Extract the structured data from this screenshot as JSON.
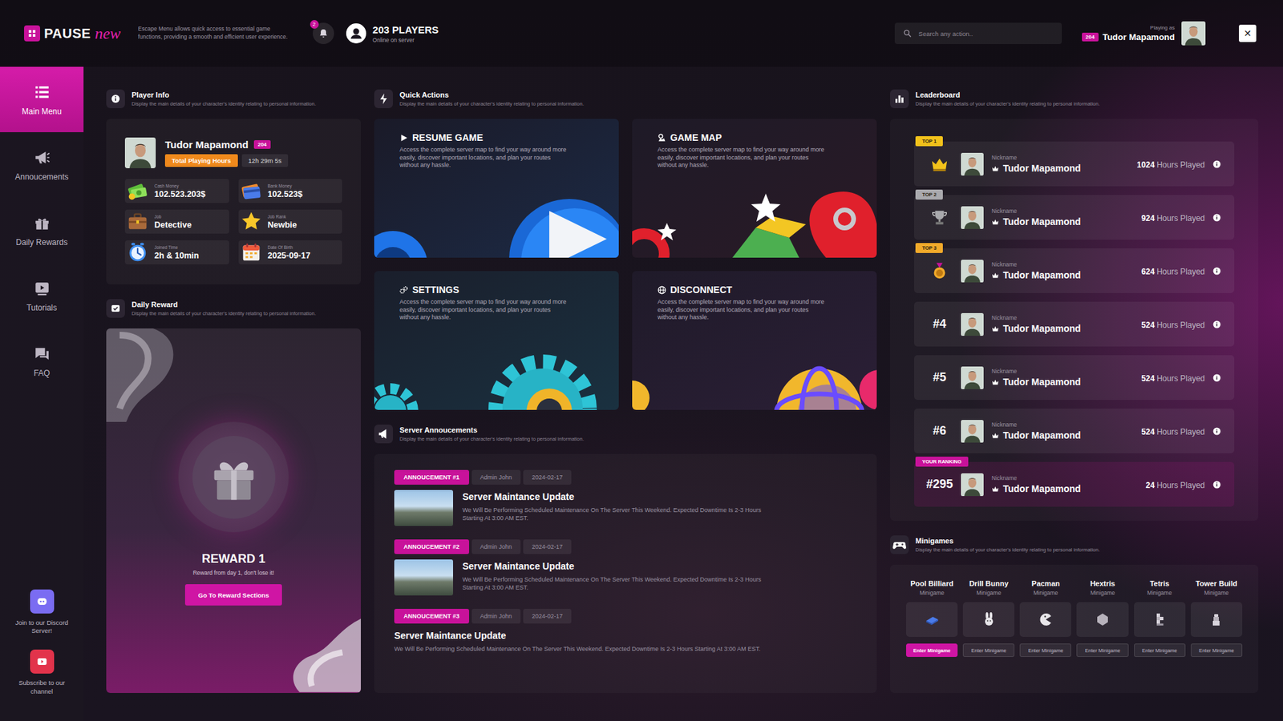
{
  "topbar": {
    "logo": {
      "text": "PAUSE",
      "script": "new"
    },
    "description": "Escape Menu allows quick access to essential game functions, providing a smooth and efficient user experience.",
    "notifications": "2",
    "players": {
      "count": "203 PLAYERS",
      "label": "Online on server"
    },
    "search": {
      "placeholder": "Search any action.."
    },
    "user": {
      "caption": "Playing as",
      "id": "204",
      "name": "Tudor Mapamond"
    },
    "close": "✕"
  },
  "sidebar": {
    "items": [
      {
        "label": "Main Menu",
        "selected": true
      },
      {
        "label": "Annoucements",
        "selected": false
      },
      {
        "label": "Daily Rewards",
        "selected": false
      },
      {
        "label": "Tutorials",
        "selected": false
      },
      {
        "label": "FAQ",
        "selected": false
      }
    ],
    "socials": [
      {
        "label": "Join to our Discord Server!",
        "color": "#7a6cf2"
      },
      {
        "label": "Subscribe to our channel",
        "color": "#e2334b"
      }
    ]
  },
  "player_info": {
    "title": "Player Info",
    "description": "Display the main details of your character's identity relating to personal information.",
    "name": "Tudor Mapamond",
    "id": "204",
    "hours_label": "Total Playing Hours",
    "hours": "12h 29m 5s",
    "stats": [
      {
        "label": "Cash Money",
        "value": "102.523.203$"
      },
      {
        "label": "Bank Money",
        "value": "102.523$"
      },
      {
        "label": "Job",
        "value": "Detective"
      },
      {
        "label": "Job Rank",
        "value": "Newbie"
      },
      {
        "label": "Joined Time",
        "value": "2h & 10min"
      },
      {
        "label": "Date Of Birth",
        "value": "2025-09-17"
      }
    ]
  },
  "daily_reward": {
    "title": "Daily Reward",
    "description": "Display the main details of your character's identity relating to personal information.",
    "reward": "REWARD 1",
    "caption": "Reward from day 1, don't lose it!",
    "button": "Go To Reward Sections"
  },
  "quick_actions": {
    "title": "Quick Actions",
    "description": "Display the main details of your character's identity relating to personal information.",
    "items": [
      {
        "title": "RESUME GAME",
        "description": "Access the complete server map to find your way around more easily, discover important locations, and plan your routes without any hassle."
      },
      {
        "title": "GAME MAP",
        "description": "Access the complete server map to find your way around more easily, discover important locations, and plan your routes without any hassle."
      },
      {
        "title": "SETTINGS",
        "description": "Access the complete server map to find your way around more easily, discover important locations, and plan your routes without any hassle."
      },
      {
        "title": "DISCONNECT",
        "description": "Access the complete server map to find your way around more easily, discover important locations, and plan your routes without any hassle."
      }
    ]
  },
  "announcements": {
    "title": "Server Annoucements",
    "description": "Display the main details of your character's identity relating to personal information.",
    "items": [
      {
        "kind": "image",
        "tag": "ANNOUCEMENT #1",
        "author": "Admin John",
        "date": "2024-02-17",
        "title": "Server Maintance Update",
        "body": "We Will Be Performing Scheduled Maintenance On The Server This Weekend. Expected Downtime Is 2-3 Hours Starting At 3:00 AM EST."
      },
      {
        "kind": "image",
        "tag": "ANNOUCEMENT #2",
        "author": "Admin John",
        "date": "2024-02-17",
        "title": "Server Maintance Update",
        "body": "We Will Be Performing Scheduled Maintenance On The Server This Weekend. Expected Downtime Is 2-3 Hours Starting At 3:00 AM EST."
      },
      {
        "kind": "text",
        "tag": "ANNOUCEMENT #3",
        "author": "Admin John",
        "date": "2024-02-17",
        "title": "Server Maintance Update",
        "body": "We Will Be Performing Scheduled Maintenance On The Server This Weekend. Expected Downtime Is 2-3 Hours Starting At 3:00 AM EST."
      }
    ]
  },
  "leaderboard": {
    "title": "Leaderboard",
    "description": "Display the main details of your character's identity relating to personal information.",
    "nickname_label": "Nickname",
    "hours_label": "Hours Played",
    "rows": [
      {
        "kind": "top",
        "badge": "TOP 1",
        "color": "#f2c21b",
        "name": "Tudor Mapamond",
        "hours": "1024"
      },
      {
        "kind": "top",
        "badge": "TOP 2",
        "color": "#a9a9ad",
        "name": "Tudor Mapamond",
        "hours": "924"
      },
      {
        "kind": "top",
        "badge": "TOP 3",
        "color": "#f0a92a",
        "name": "Tudor Mapamond",
        "hours": "624"
      },
      {
        "kind": "rank",
        "rank": "#4",
        "name": "Tudor Mapamond",
        "hours": "524"
      },
      {
        "kind": "rank",
        "rank": "#5",
        "name": "Tudor Mapamond",
        "hours": "524"
      },
      {
        "kind": "rank",
        "rank": "#6",
        "name": "Tudor Mapamond",
        "hours": "524"
      },
      {
        "kind": "self",
        "badge": "YOUR RANKING",
        "color": "#c8129a",
        "rank": "#295",
        "name": "Tudor Mapamond",
        "hours": "24"
      }
    ]
  },
  "minigames": {
    "title": "Minigames",
    "description": "Display the main details of your character's identity relating to personal information.",
    "items": [
      {
        "name": "Pool Billiard",
        "sub": "Minigame",
        "button": "Enter Minigame",
        "selected": true
      },
      {
        "name": "Drill Bunny",
        "sub": "Minigame",
        "button": "Enter Minigame",
        "selected": false
      },
      {
        "name": "Pacman",
        "sub": "Minigame",
        "button": "Enter Minigame",
        "selected": false
      },
      {
        "name": "Hextris",
        "sub": "Minigame",
        "button": "Enter Minigame",
        "selected": false
      },
      {
        "name": "Tetris",
        "sub": "Minigame",
        "button": "Enter Minigame",
        "selected": false
      },
      {
        "name": "Tower Build",
        "sub": "Minigame",
        "button": "Enter Minigame",
        "selected": false
      }
    ]
  }
}
